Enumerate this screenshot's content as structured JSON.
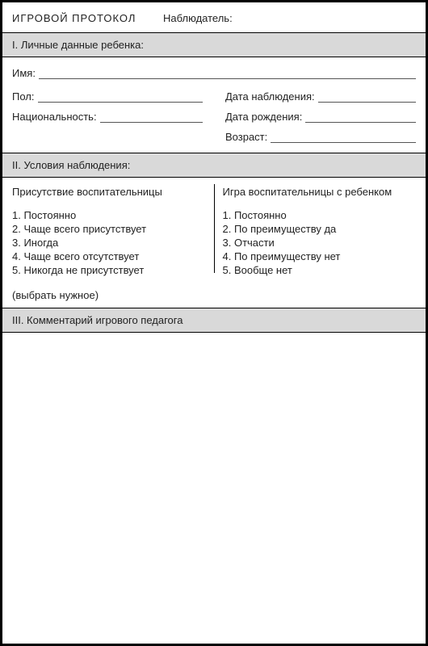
{
  "header": {
    "title": "ИГРОВОЙ  ПРОТОКОЛ",
    "observer_label": "Наблюдатель:"
  },
  "section1": {
    "header": "I. Личные данные ребенка:",
    "name_label": "Имя:",
    "gender_label": "Пол:",
    "nationality_label": "Национальность:",
    "obs_date_label": "Дата наблюдения:",
    "birth_date_label": "Дата рождения:",
    "age_label": "Возраст:"
  },
  "section2": {
    "header": "II. Условия наблюдения:",
    "left_title": "Присутствие воспитательницы",
    "right_title": "Игра воспитательницы с ребенком",
    "left_items": [
      "1. Постоянно",
      "2. Чаще всего присутствует",
      "3. Иногда",
      "4. Чаще всего отсутствует",
      "5. Никогда не присутствует"
    ],
    "right_items": [
      "1. Постоянно",
      "2. По преимуществу да",
      "3. Отчасти",
      "4. По преимуществу нет",
      "5. Вообще нет"
    ],
    "choose_note": "(выбрать нужное)"
  },
  "section3": {
    "header": "III. Комментарий игрового педагога"
  }
}
